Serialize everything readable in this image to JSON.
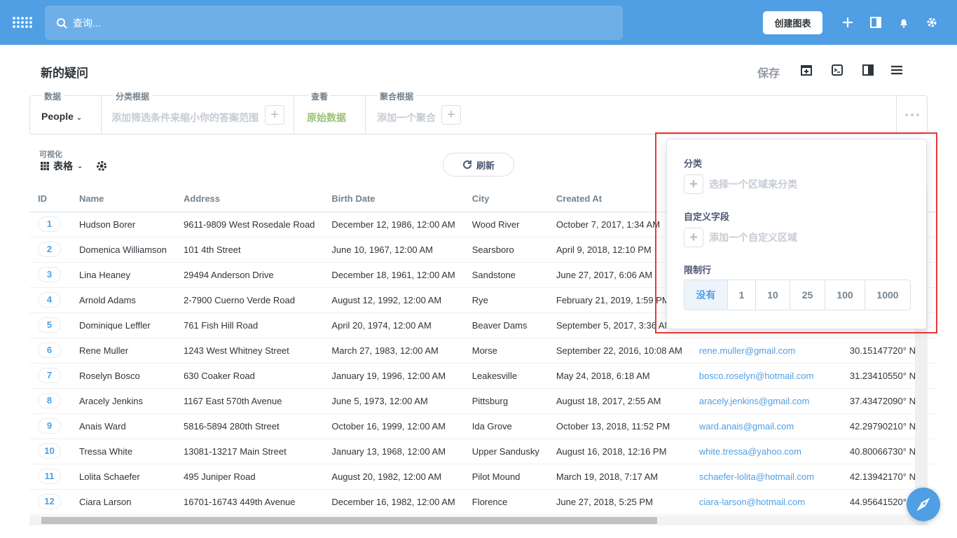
{
  "topbar": {
    "search_placeholder": "查询...",
    "create_button": "创建图表",
    "icons": [
      "metabase-logo-icon",
      "search-icon",
      "plus-icon",
      "notebook-icon",
      "bell-icon",
      "gear-icon"
    ]
  },
  "header": {
    "title": "新的疑问",
    "save_label": "保存"
  },
  "query_builder": {
    "data_label": "数据",
    "data_value": "People",
    "filter_label": "分类根据",
    "filter_placeholder": "添加筛选条件来缩小你的答案范围",
    "view_label": "查看",
    "view_value": "原始数据",
    "aggregate_label": "聚合根据",
    "aggregate_placeholder": "添加一个聚合"
  },
  "visualization": {
    "label": "可视化",
    "type": "表格",
    "refresh_label": "刷新"
  },
  "table": {
    "columns": [
      "ID",
      "Name",
      "Address",
      "Birth Date",
      "City",
      "Created At",
      "",
      ""
    ],
    "rows": [
      [
        "1",
        "Hudson Borer",
        "9611-9809 West Rosedale Road",
        "December 12, 1986, 12:00 AM",
        "Wood River",
        "October 7, 2017, 1:34 AM",
        "",
        ""
      ],
      [
        "2",
        "Domenica Williamson",
        "101 4th Street",
        "June 10, 1967, 12:00 AM",
        "Searsboro",
        "April 9, 2018, 12:10 PM",
        "",
        ""
      ],
      [
        "3",
        "Lina Heaney",
        "29494 Anderson Drive",
        "December 18, 1961, 12:00 AM",
        "Sandstone",
        "June 27, 2017, 6:06 AM",
        "",
        ""
      ],
      [
        "4",
        "Arnold Adams",
        "2-7900 Cuerno Verde Road",
        "August 12, 1992, 12:00 AM",
        "Rye",
        "February 21, 2019, 1:59 PM",
        "",
        ""
      ],
      [
        "5",
        "Dominique Leffler",
        "761 Fish Hill Road",
        "April 20, 1974, 12:00 AM",
        "Beaver Dams",
        "September 5, 2017, 3:36 AM",
        "",
        ""
      ],
      [
        "6",
        "Rene Muller",
        "1243 West Whitney Street",
        "March 27, 1983, 12:00 AM",
        "Morse",
        "September 22, 2016, 10:08 AM",
        "rene.muller@gmail.com",
        "30.15147720° N"
      ],
      [
        "7",
        "Roselyn Bosco",
        "630 Coaker Road",
        "January 19, 1996, 12:00 AM",
        "Leakesville",
        "May 24, 2018, 6:18 AM",
        "bosco.roselyn@hotmail.com",
        "31.23410550° N"
      ],
      [
        "8",
        "Aracely Jenkins",
        "1167 East 570th Avenue",
        "June 5, 1973, 12:00 AM",
        "Pittsburg",
        "August 18, 2017, 2:55 AM",
        "aracely.jenkins@gmail.com",
        "37.43472090° N"
      ],
      [
        "9",
        "Anais Ward",
        "5816-5894 280th Street",
        "October 16, 1999, 12:00 AM",
        "Ida Grove",
        "October 13, 2018, 11:52 PM",
        "ward.anais@gmail.com",
        "42.29790210° N"
      ],
      [
        "10",
        "Tressa White",
        "13081-13217 Main Street",
        "January 13, 1968, 12:00 AM",
        "Upper Sandusky",
        "August 16, 2018, 12:16 PM",
        "white.tressa@yahoo.com",
        "40.80066730° N"
      ],
      [
        "11",
        "Lolita Schaefer",
        "495 Juniper Road",
        "August 20, 1982, 12:00 AM",
        "Pilot Mound",
        "March 19, 2018, 7:17 AM",
        "schaefer-lolita@hotmail.com",
        "42.13942170° N"
      ],
      [
        "12",
        "Ciara Larson",
        "16701-16743 449th Avenue",
        "December 16, 1982, 12:00 AM",
        "Florence",
        "June 27, 2018, 5:25 PM",
        "ciara-larson@hotmail.com",
        "44.95641520° N"
      ]
    ]
  },
  "popover": {
    "breakout_label": "分类",
    "breakout_placeholder": "选择一个区域来分类",
    "custom_field_label": "自定义字段",
    "custom_field_placeholder": "添加一个自定义区域",
    "limit_label": "限制行",
    "limit_options": [
      "没有",
      "1",
      "10",
      "25",
      "100",
      "1000"
    ],
    "limit_selected": "没有"
  },
  "colors": {
    "brand": "#509ee3",
    "highlight_frame": "#e53935"
  }
}
